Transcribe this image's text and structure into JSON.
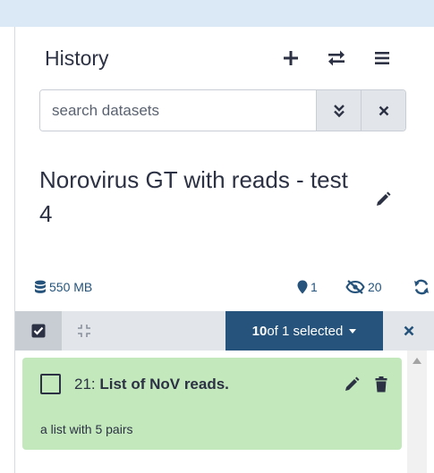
{
  "history": {
    "title": "History",
    "buttons": {
      "create": "plus-icon",
      "switch": "exchange-icon",
      "options": "bars-icon"
    }
  },
  "search": {
    "placeholder": "search datasets",
    "value": ""
  },
  "history_name": "Norovirus GT with reads - test 4",
  "stats": {
    "size": "550 MB",
    "deleted_count": "1",
    "hidden_count": "20"
  },
  "selection": {
    "label_prefix": "10",
    "label_suffix": " of 1 selected"
  },
  "items": [
    {
      "hid": "21:",
      "name": "List of NoV reads.",
      "description": "a list with 5 pairs",
      "state_color": "#c2e8bc"
    }
  ],
  "colors": {
    "accent": "#25537b",
    "header_band": "#dbe9f7",
    "ok_state": "#c2e8bc",
    "text": "#2c3143"
  }
}
